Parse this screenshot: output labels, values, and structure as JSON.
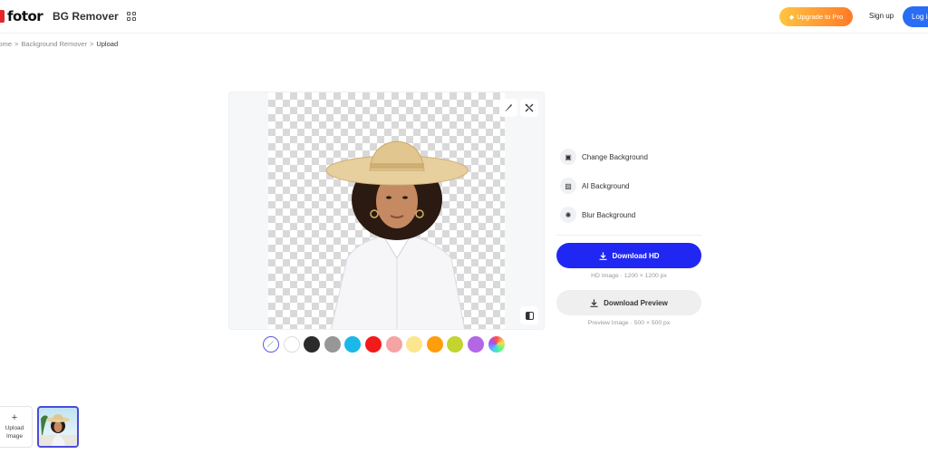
{
  "header": {
    "logo_text": "fotor",
    "product_name": "BG Remover",
    "apps_icon": "grid-icon",
    "upgrade_label": "Upgrade to Pro",
    "signup_label": "Sign up",
    "login_label": "Log in"
  },
  "breadcrumb": {
    "items": [
      "Home",
      "Background Remover",
      "Upload"
    ],
    "separator": ">"
  },
  "canvas": {
    "tools": {
      "brush_icon": "brush-icon",
      "erase_icon": "magic-erase-icon",
      "compare_icon": "compare-icon"
    }
  },
  "swatches": [
    {
      "name": "transparent",
      "color": "#ffffff"
    },
    {
      "name": "white",
      "color": "#ffffff"
    },
    {
      "name": "black",
      "color": "#2b2b2b"
    },
    {
      "name": "gray",
      "color": "#979797"
    },
    {
      "name": "cyan",
      "color": "#19b8e8"
    },
    {
      "name": "red",
      "color": "#f21a1a"
    },
    {
      "name": "pink",
      "color": "#f5a3a3"
    },
    {
      "name": "light-yellow",
      "color": "#fbe68e"
    },
    {
      "name": "orange",
      "color": "#ff9d0a"
    },
    {
      "name": "lime",
      "color": "#c2d42e"
    },
    {
      "name": "purple",
      "color": "#b366e6"
    },
    {
      "name": "custom",
      "color": "conic"
    }
  ],
  "options": [
    {
      "label": "Change Background",
      "icon": "image-frame-icon"
    },
    {
      "label": "AI Background",
      "icon": "ai-image-icon"
    },
    {
      "label": "Blur Background",
      "icon": "blur-icon"
    }
  ],
  "download": {
    "hd_label": "Download HD",
    "hd_info": "HD Image · 1200 × 1200 px",
    "preview_label": "Download Preview",
    "preview_info": "Preview Image · 500 × 500 px"
  },
  "bottom": {
    "upload_label_line1": "Upload",
    "upload_label_line2": "Image"
  },
  "colors": {
    "primary": "#2127f3",
    "accent_selected": "#4b4bd8",
    "login": "#2a6df5"
  }
}
